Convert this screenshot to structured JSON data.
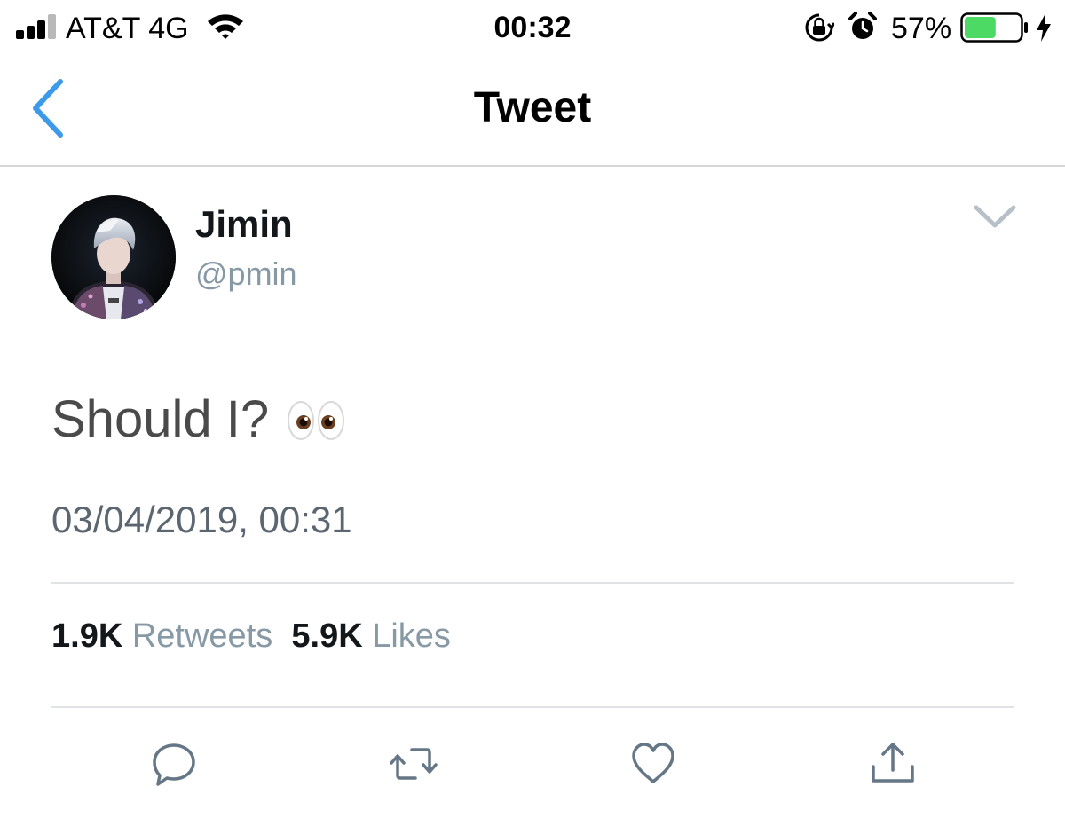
{
  "status_bar": {
    "carrier": "AT&T 4G",
    "time": "00:32",
    "battery_percent": "57%",
    "battery_level": 0.57,
    "battery_color": "#4cd964",
    "icons": [
      "signal-icon",
      "wifi-icon",
      "orientation-lock-icon",
      "alarm-icon",
      "battery-icon",
      "charging-bolt-icon"
    ]
  },
  "nav": {
    "title": "Tweet",
    "back_icon": "chevron-left-icon",
    "accent_color": "#3d9ae8"
  },
  "tweet": {
    "author": {
      "display_name": "Jimin",
      "handle": "@pmin"
    },
    "text": "Should I?",
    "emoji": "eyes-emoji",
    "timestamp": "03/04/2019, 00:31",
    "stats": {
      "retweets_count": "1.9K",
      "retweets_label": "Retweets",
      "likes_count": "5.9K",
      "likes_label": "Likes"
    },
    "actions": [
      "reply-icon",
      "retweet-icon",
      "like-icon",
      "share-icon"
    ]
  }
}
